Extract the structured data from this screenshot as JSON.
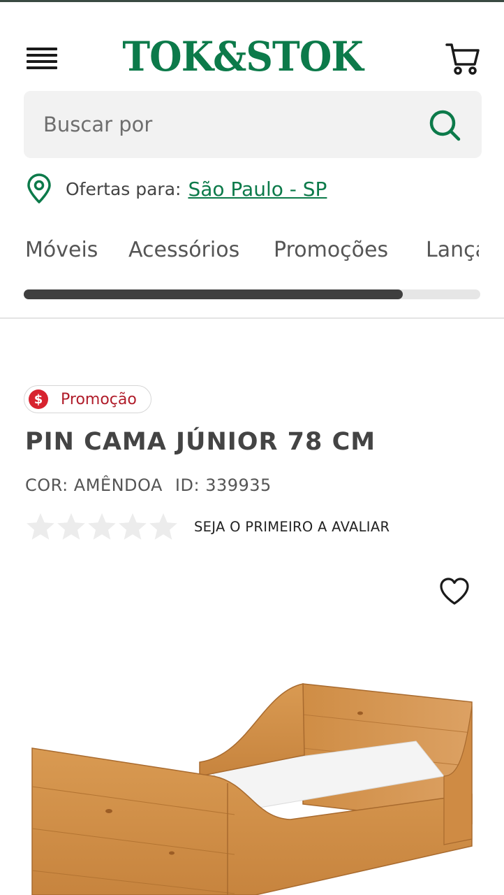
{
  "brand": {
    "logo_text": "TOK&STOK",
    "color": "#0c7a4a"
  },
  "header": {
    "menu_icon": "hamburger-menu-icon",
    "cart_icon": "shopping-cart-icon"
  },
  "search": {
    "placeholder": "Buscar por",
    "icon": "search-icon"
  },
  "location": {
    "label": "Ofertas para:",
    "city": "São Paulo - SP",
    "icon": "map-pin-icon"
  },
  "nav": {
    "tabs": [
      "Móveis",
      "Acessórios",
      "Promoções",
      "Lançamentos"
    ],
    "scroll_position": 0.83
  },
  "product": {
    "badge": "Promoção",
    "badge_icon": "dollar-icon",
    "badge_color": "#d7232f",
    "title": "PIN CAMA JÚNIOR 78 CM",
    "color_label": "COR: AMÊNDOA",
    "id_label": "ID: 339935",
    "rating": {
      "stars_filled": 0,
      "stars_total": 5,
      "cta": "SEJA O PRIMEIRO A AVALIAR"
    },
    "favorite_icon": "heart-icon",
    "image": "wooden-junior-bed-image"
  }
}
